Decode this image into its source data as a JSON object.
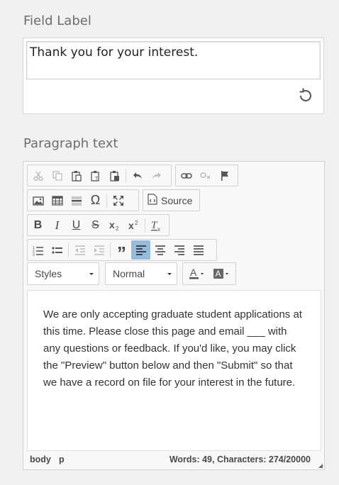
{
  "field_label": {
    "title": "Field Label",
    "value": "Thank you for your interest."
  },
  "paragraph": {
    "title": "Paragraph text",
    "toolbar": {
      "source_label": "Source",
      "styles_label": "Styles",
      "format_label": "Normal"
    },
    "content": "We are only accepting graduate student applications at this time. Please close this page and email ___ with any questions or feedback. If you'd like, you may click the \"Preview\" button below and then \"Submit\" so that we have a record on file for your interest in the future.",
    "path": [
      "body",
      "p"
    ],
    "word_count": "Words: 49, Characters: 274/20000"
  },
  "colors": {
    "active_button": "#92bce0",
    "text": "#333333"
  }
}
